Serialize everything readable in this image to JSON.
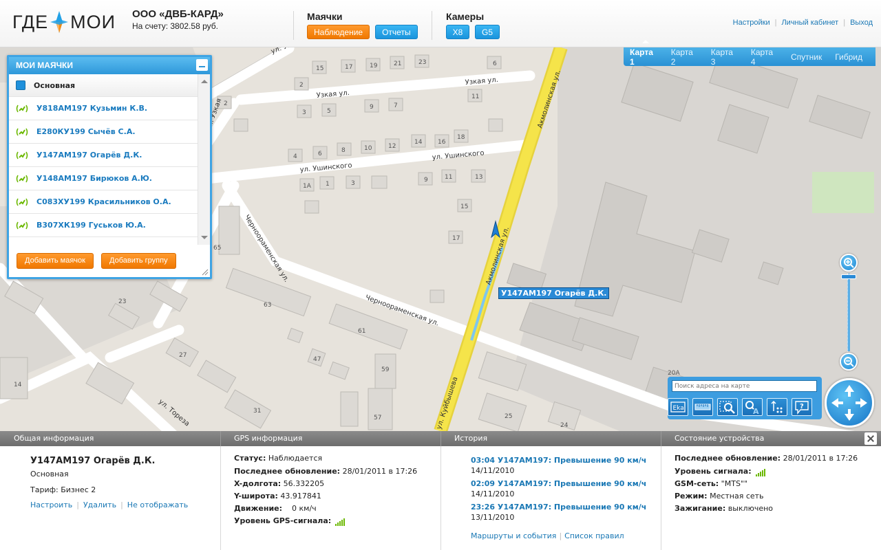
{
  "header": {
    "logo": {
      "left": "ГДЕ",
      "right": "МОИ"
    },
    "company": {
      "name": "ООО «ДВБ-КАРД»",
      "balance": "На счету: 3802.58 руб."
    },
    "beacons_group": {
      "title": "Маячки",
      "buttons": [
        "Наблюдение",
        "Отчеты"
      ]
    },
    "cameras_group": {
      "title": "Камеры",
      "buttons": [
        "X8",
        "G5"
      ]
    },
    "links": [
      "Настройки",
      "Личный кабинет",
      "Выход"
    ]
  },
  "map": {
    "tabs": [
      "Карта 1",
      "Карта 2",
      "Карта 3",
      "Карта 4",
      "Спутник",
      "Гибрид"
    ],
    "active_tab": "Карта 1",
    "streets": [
      "ул. Узкая ул.",
      "Узкая ул.",
      "Узкая ул.",
      "ул. Ушинского",
      "ул. Ушинского",
      "Акмолинская ул.",
      "Акмолинская ул.",
      "Черноораменская ул.",
      "Черноораменская ул.",
      "ул. Тореза",
      "ул. Куйбышева"
    ],
    "vehicle_label": "У147АМ197 Огарёв Д.К.",
    "search_placeholder": "Поиск адреса на карте",
    "tool_icons": [
      "ekl-icon",
      "ruler-icon",
      "zoom-area-icon",
      "search-text-icon",
      "route-icon",
      "help-icon"
    ]
  },
  "beacons_panel": {
    "title": "МОИ МАЯЧКИ",
    "group": "Основная",
    "items": [
      "У818АМ197 Кузьмин К.В.",
      "Е280КУ199 Сычёв С.А.",
      "У147АМ197 Огарёв Д.К.",
      "У148АМ197 Бирюков А.Ю.",
      "С083ХУ199 Красильников О.А.",
      "В307ХК199 Гуськов Ю.А."
    ],
    "add_beacon": "Добавить маячок",
    "add_group": "Добавить группу"
  },
  "info": {
    "general": {
      "title": "Общая информация",
      "name": "У147АМ197 Огарёв Д.К.",
      "group": "Основная",
      "tariff": "Тариф: Бизнес 2",
      "links": [
        "Настроить",
        "Удалить",
        "Не отображать"
      ]
    },
    "gps": {
      "title": "GPS информация",
      "rows": [
        {
          "k": "Статус:",
          "v": " Наблюдается"
        },
        {
          "k": "Последнее обновление:",
          "v": " 28/01/2011 в 17:26"
        },
        {
          "k": "X-долгота:",
          "v": " 56.332205"
        },
        {
          "k": "Y-широта:",
          "v": " 43.917841"
        },
        {
          "k": "Движение:",
          "v": "    0 км/ч"
        },
        {
          "k": "Уровень GPS-сигнала:",
          "v": ""
        }
      ]
    },
    "history": {
      "title": "История",
      "events": [
        {
          "title": "03:04 У147АМ197: Превышение 90 км/ч",
          "date": "14/11/2010"
        },
        {
          "title": "02:09 У147АМ197: Превышение 90 км/ч",
          "date": "14/11/2010"
        },
        {
          "title": "23:26 У147АМ197: Превышение 90 км/ч",
          "date": "13/11/2010"
        }
      ],
      "links": [
        "Маршруты и события",
        "Список правил"
      ]
    },
    "device": {
      "title": "Состояние устройства",
      "rows": [
        {
          "k": "Последнее обновление:",
          "v": " 28/01/2011 в 17:26"
        },
        {
          "k": "Уровень сигнала:",
          "v": ""
        },
        {
          "k": "GSM-сеть:",
          "v": " \"MTS\"\""
        },
        {
          "k": "Режим:",
          "v": " Местная сеть"
        },
        {
          "k": "Зажигание:",
          "v": " выключено"
        }
      ]
    }
  },
  "colors": {
    "accent_orange": "#f58a0f",
    "accent_blue": "#2a91d4",
    "link": "#1a78b5",
    "road_yellow": "#f5e44a"
  }
}
